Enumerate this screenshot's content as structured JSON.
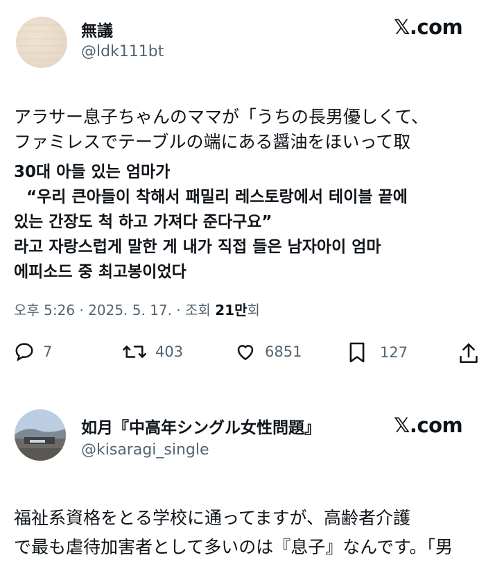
{
  "post1": {
    "display_name": "無議",
    "handle": "@ldk111bt",
    "source_label": "𝕏.com",
    "text_ja": [
      "アラサー息子ちゃんのママが「うちの長男優しくて、",
      "ファミレスでテーブルの端にある醤油をほいって取"
    ],
    "text_ko": [
      "30대 아들 있는 엄마가",
      " “우리 큰아들이 착해서 패밀리 레스토랑에서 테이블 끝에",
      "있는 간장도 척 하고 가져다 준다구요”",
      "라고 자랑스럽게 말한 게 내가 직접 들은 남자아이 엄마",
      "에피소드 중 최고봉이었다"
    ],
    "meta": {
      "time": "오후 5:26",
      "date": "2025. 5. 17.",
      "views_prefix": "조회",
      "views_value": "21만",
      "views_suffix": "회",
      "sep": "·"
    },
    "actions": {
      "replies": "7",
      "reposts": "403",
      "likes": "6851",
      "bookmarks": "127"
    }
  },
  "post2": {
    "display_name": "如月『中高年シングル女性問題』",
    "handle": "@kisaragi_single",
    "source_label": "𝕏.com",
    "text_ja": [
      "福祉系資格をとる学校に通ってますが、高齢者介護",
      "で最も虐待加害者として多いのは『息子』なんです。「男"
    ]
  },
  "icons": [
    "reply-icon",
    "repost-icon",
    "like-icon",
    "bookmark-icon",
    "share-icon"
  ]
}
